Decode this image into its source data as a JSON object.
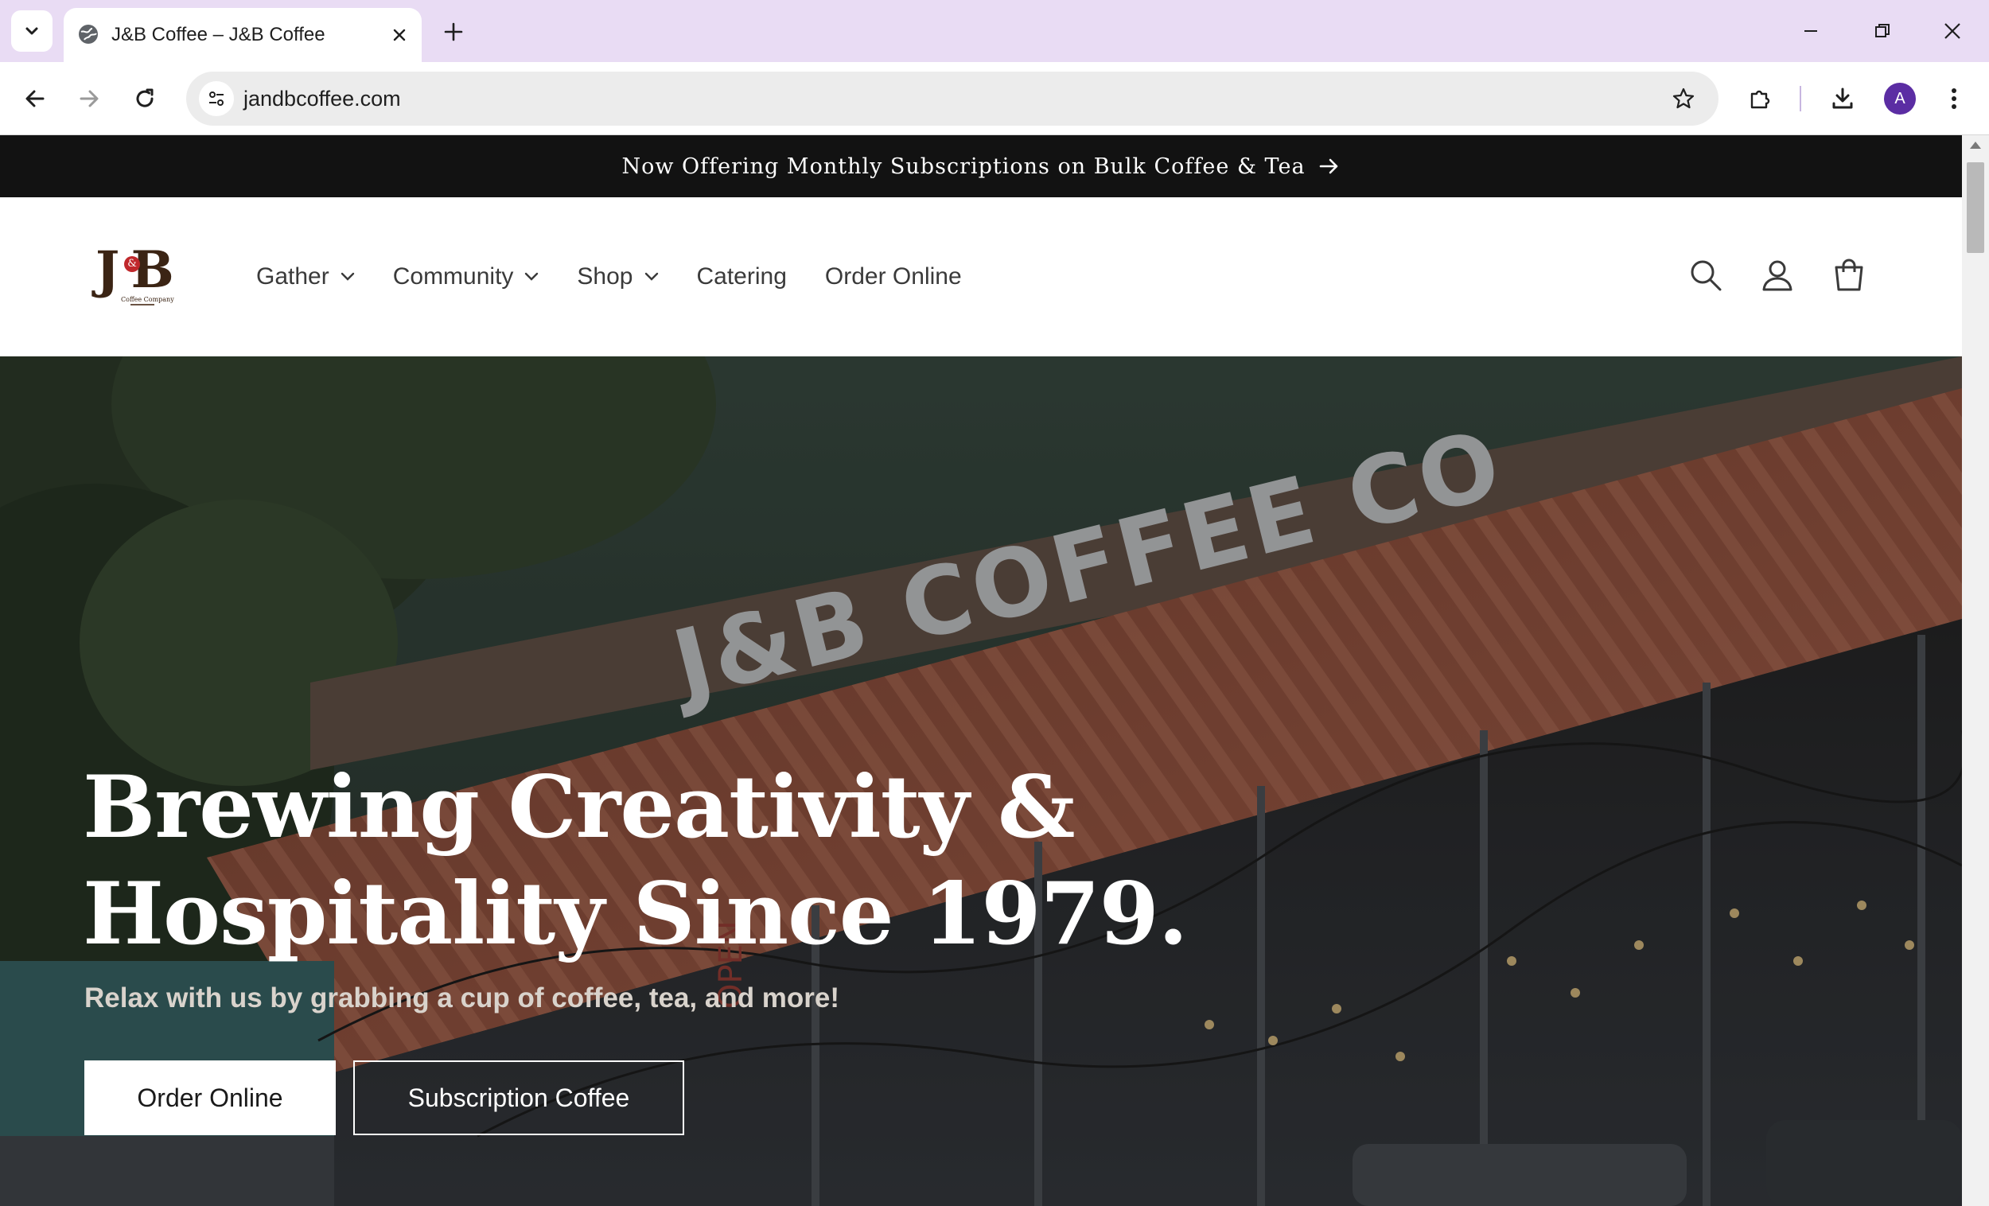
{
  "browser": {
    "tab_title": "J&B Coffee – J&B Coffee",
    "url": "jandbcoffee.com",
    "profile_initial": "A",
    "accent_color": "#e9dcf4"
  },
  "announcement": {
    "text": "Now Offering Monthly Subscriptions on Bulk Coffee & Tea"
  },
  "header": {
    "logo_alt": "J&B Coffee Company",
    "logo_mark": "J B",
    "logo_amp": "&",
    "logo_tagline": "Coffee Company",
    "nav": [
      {
        "label": "Gather",
        "has_dropdown": true
      },
      {
        "label": "Community",
        "has_dropdown": true
      },
      {
        "label": "Shop",
        "has_dropdown": true
      },
      {
        "label": "Catering",
        "has_dropdown": false
      },
      {
        "label": "Order Online",
        "has_dropdown": false
      }
    ],
    "icons": [
      "search-icon",
      "account-icon",
      "cart-icon"
    ]
  },
  "hero": {
    "heading_line1": "Brewing Creativity &",
    "heading_line2": "Hospitality Since 1979.",
    "subheading": "Relax with us by grabbing a cup of coffee, tea, and more!",
    "primary_button": "Order Online",
    "secondary_button": "Subscription Coffee",
    "sign_text": "J&B COFFEE CO",
    "window_sign": "OPEN"
  },
  "colors": {
    "announcement_bg": "#121212",
    "text_dark": "#3a3a3a",
    "logo_brown": "#3b2414",
    "logo_red": "#c0282c"
  }
}
